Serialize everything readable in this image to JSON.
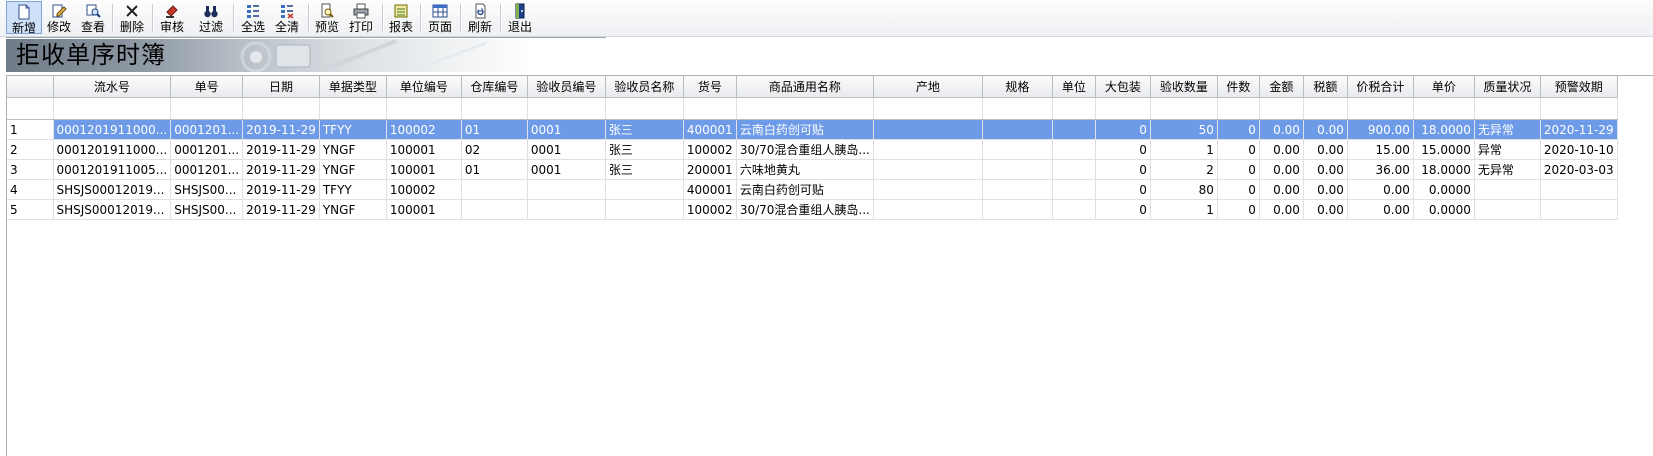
{
  "toolbar": {
    "buttons": [
      {
        "label": "新增",
        "icon": "new-document-icon"
      },
      {
        "label": "修改",
        "icon": "edit-icon"
      },
      {
        "label": "查看",
        "icon": "view-icon"
      },
      {
        "label": "删除",
        "icon": "delete-icon"
      },
      {
        "label": "审核",
        "icon": "audit-icon"
      },
      {
        "label": "过滤",
        "icon": "filter-binoculars-icon"
      },
      {
        "label": "全选",
        "icon": "select-all-icon"
      },
      {
        "label": "全清",
        "icon": "clear-all-icon"
      },
      {
        "label": "预览",
        "icon": "preview-icon"
      },
      {
        "label": "打印",
        "icon": "printer-icon"
      },
      {
        "label": "报表",
        "icon": "report-icon"
      },
      {
        "label": "页面",
        "icon": "page-grid-icon"
      },
      {
        "label": "刷新",
        "icon": "refresh-icon"
      },
      {
        "label": "退出",
        "icon": "exit-door-icon"
      }
    ]
  },
  "banner": {
    "title": "拒收单序时簿"
  },
  "grid": {
    "columns": [
      "",
      "流水号",
      "单号",
      "日期",
      "单据类型",
      "单位编号",
      "仓库编号",
      "验收员编号",
      "验收员名称",
      "货号",
      "商品通用名称",
      "产地",
      "规格",
      "单位",
      "大包装",
      "验收数量",
      "件数",
      "金额",
      "税额",
      "价税合计",
      "单价",
      "质量状况",
      "预警效期"
    ],
    "rows": [
      [
        "1",
        "0001201911000...",
        "0001201...",
        "2019-11-29",
        "TFYY",
        "100002",
        "01",
        "0001",
        "张三",
        "400001",
        "云南白药创可贴",
        "",
        "",
        "",
        "0",
        "50",
        "0",
        "0.00",
        "0.00",
        "900.00",
        "18.0000",
        "无异常",
        "2020-11-29"
      ],
      [
        "2",
        "0001201911000...",
        "0001201...",
        "2019-11-29",
        "YNGF",
        "100001",
        "02",
        "0001",
        "张三",
        "100002",
        "30/70混合重组人胰岛...",
        "",
        "",
        "",
        "0",
        "1",
        "0",
        "0.00",
        "0.00",
        "15.00",
        "15.0000",
        "异常",
        "2020-10-10"
      ],
      [
        "3",
        "0001201911005...",
        "0001201...",
        "2019-11-29",
        "YNGF",
        "100001",
        "01",
        "0001",
        "张三",
        "200001",
        "六味地黄丸",
        "",
        "",
        "",
        "0",
        "2",
        "0",
        "0.00",
        "0.00",
        "36.00",
        "18.0000",
        "无异常",
        "2020-03-03"
      ],
      [
        "4",
        "SHSJS00012019...",
        "SHSJS00...",
        "2019-11-29",
        "TFYY",
        "100002",
        "",
        "",
        "",
        "400001",
        "云南白药创可贴",
        "",
        "",
        "",
        "0",
        "80",
        "0",
        "0.00",
        "0.00",
        "0.00",
        "0.0000",
        "",
        ""
      ],
      [
        "5",
        "SHSJS00012019...",
        "SHSJS00...",
        "2019-11-29",
        "YNGF",
        "100001",
        "",
        "",
        "",
        "100002",
        "30/70混合重组人胰岛...",
        "",
        "",
        "",
        "0",
        "1",
        "0",
        "0.00",
        "0.00",
        "0.00",
        "0.0000",
        "",
        ""
      ]
    ],
    "selected_row": 0
  },
  "colors": {
    "selection": "#6e9be8",
    "toolbar_active": "#cfe1f8"
  }
}
